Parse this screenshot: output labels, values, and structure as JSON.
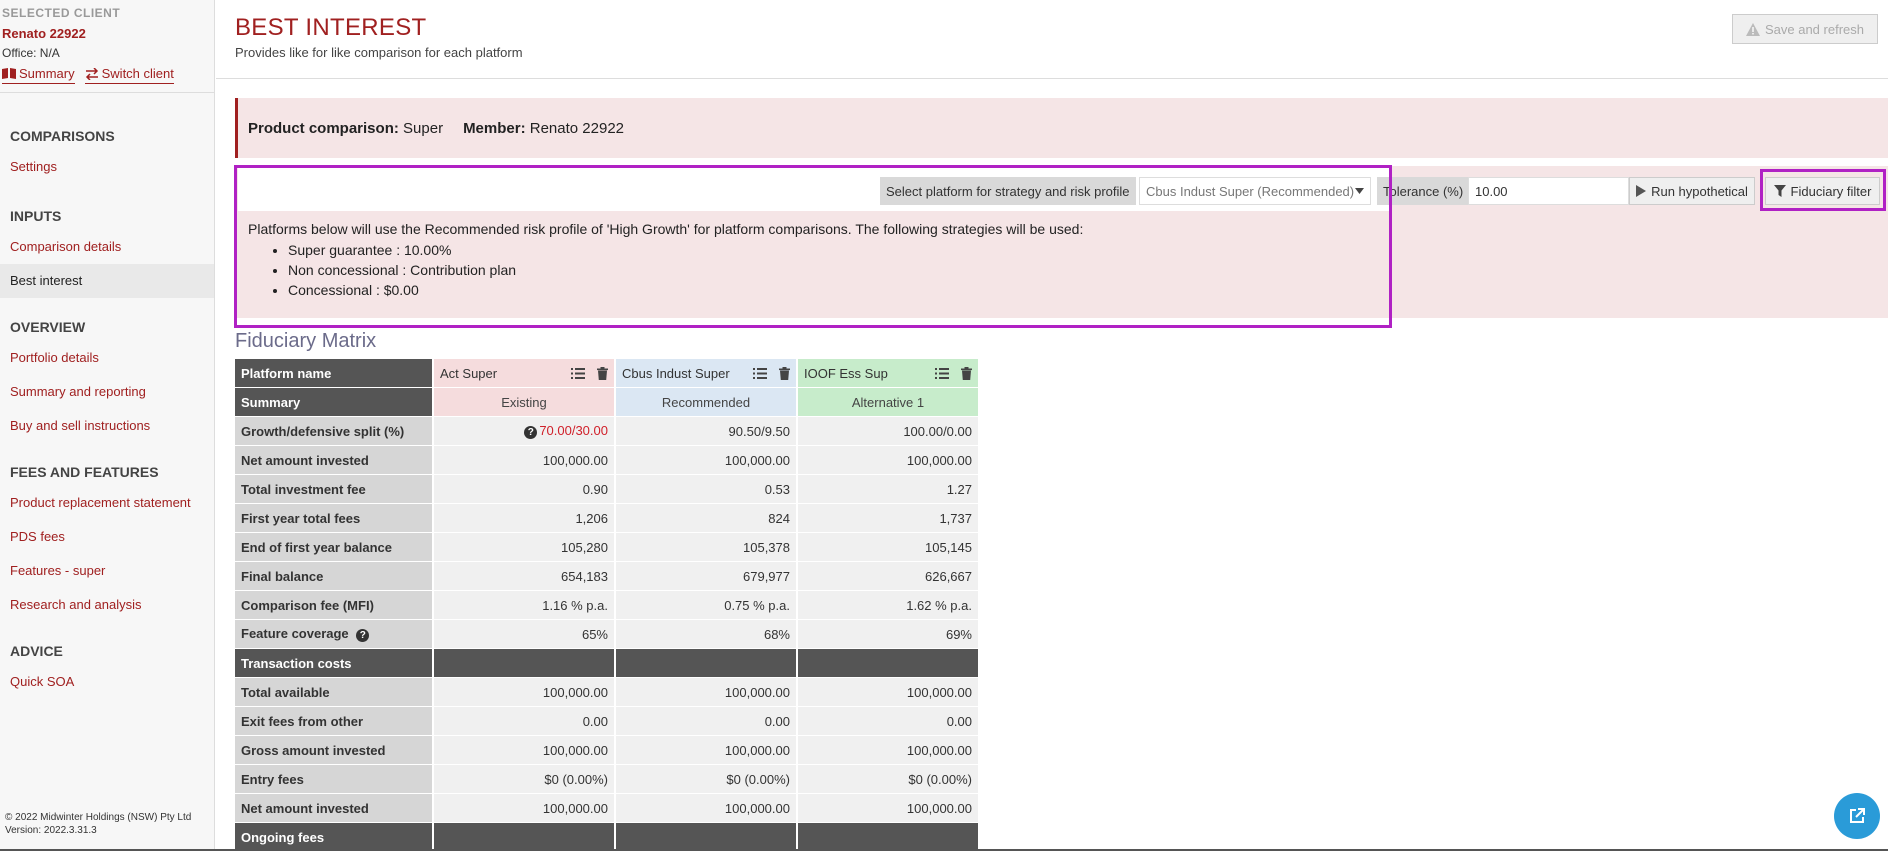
{
  "client": {
    "heading": "SELECTED CLIENT",
    "name": "Renato 22922",
    "office": "Office: N/A",
    "summary_link": "Summary",
    "switch_link": "Switch client"
  },
  "nav": {
    "comparisons": {
      "title": "COMPARISONS",
      "items": [
        "Settings"
      ]
    },
    "inputs": {
      "title": "INPUTS",
      "items": [
        "Comparison details",
        "Best interest"
      ]
    },
    "overview": {
      "title": "OVERVIEW",
      "items": [
        "Portfolio details",
        "Summary and reporting",
        "Buy and sell instructions"
      ]
    },
    "fees": {
      "title": "FEES AND FEATURES",
      "items": [
        "Product replacement statement",
        "PDS fees",
        "Features - super",
        "Research and analysis"
      ]
    },
    "advice": {
      "title": "ADVICE",
      "items": [
        "Quick SOA"
      ]
    }
  },
  "footer": {
    "copyright": "© 2022 Midwinter Holdings (NSW) Pty Ltd",
    "version": "Version: 2022.3.31.3"
  },
  "header": {
    "title": "BEST INTEREST",
    "subtitle": "Provides like for like comparison for each platform",
    "save_button": "Save and refresh"
  },
  "banner": {
    "product_label": "Product comparison:",
    "product_value": "Super",
    "member_label": "Member:",
    "member_value": "Renato 22922"
  },
  "controls": {
    "platform_label": "Select platform for strategy and risk profile",
    "platform_selected": "Cbus Indust Super (Recommended)",
    "tolerance_label": "Tolerance (%)",
    "tolerance_value": "10.00",
    "run_button": "Run hypothetical",
    "filter_button": "Fiduciary filter"
  },
  "strategy": {
    "intro": "Platforms below will use the Recommended risk profile of 'High Growth' for platform comparisons. The following strategies will be used:",
    "items": [
      "Super guarantee : 10.00%",
      "Non concessional : Contribution plan",
      "Concessional : $0.00"
    ]
  },
  "matrix": {
    "title": "Fiduciary Matrix",
    "platform_name_label": "Platform name",
    "summary_label": "Summary",
    "platforms": [
      {
        "name": "Act Super",
        "role": "Existing"
      },
      {
        "name": "Cbus Indust Super",
        "role": "Recommended"
      },
      {
        "name": "IOOF Ess Sup",
        "role": "Alternative 1"
      }
    ],
    "rows": [
      {
        "label": "Growth/defensive split (%)",
        "values": [
          "70.00/30.00",
          "90.50/9.50",
          "100.00/0.00"
        ]
      },
      {
        "label": "Net amount invested",
        "values": [
          "100,000.00",
          "100,000.00",
          "100,000.00"
        ]
      },
      {
        "label": "Total investment fee",
        "values": [
          "0.90",
          "0.53",
          "1.27"
        ]
      },
      {
        "label": "First year total fees",
        "values": [
          "1,206",
          "824",
          "1,737"
        ]
      },
      {
        "label": "End of first year balance",
        "values": [
          "105,280",
          "105,378",
          "105,145"
        ]
      },
      {
        "label": "Final balance",
        "values": [
          "654,183",
          "679,977",
          "626,667"
        ]
      },
      {
        "label": "Comparison fee (MFI)",
        "values": [
          "1.16 % p.a.",
          "0.75 % p.a.",
          "1.62 % p.a."
        ]
      },
      {
        "label": "Feature coverage",
        "values": [
          "65%",
          "68%",
          "69%"
        ]
      }
    ],
    "transaction_label": "Transaction costs",
    "transaction_rows": [
      {
        "label": "Total available",
        "values": [
          "100,000.00",
          "100,000.00",
          "100,000.00"
        ]
      },
      {
        "label": "Exit fees from other",
        "values": [
          "0.00",
          "0.00",
          "0.00"
        ]
      },
      {
        "label": "Gross amount invested",
        "values": [
          "100,000.00",
          "100,000.00",
          "100,000.00"
        ]
      },
      {
        "label": "Entry fees",
        "values": [
          "$0 (0.00%)",
          "$0 (0.00%)",
          "$0 (0.00%)"
        ]
      },
      {
        "label": "Net amount invested",
        "values": [
          "100,000.00",
          "100,000.00",
          "100,000.00"
        ]
      }
    ],
    "ongoing_label": "Ongoing fees"
  },
  "colors": {
    "brand": "#a02020",
    "highlight": "#b021c4",
    "best_value": "#2db63a",
    "warning_value": "#d0202a"
  }
}
